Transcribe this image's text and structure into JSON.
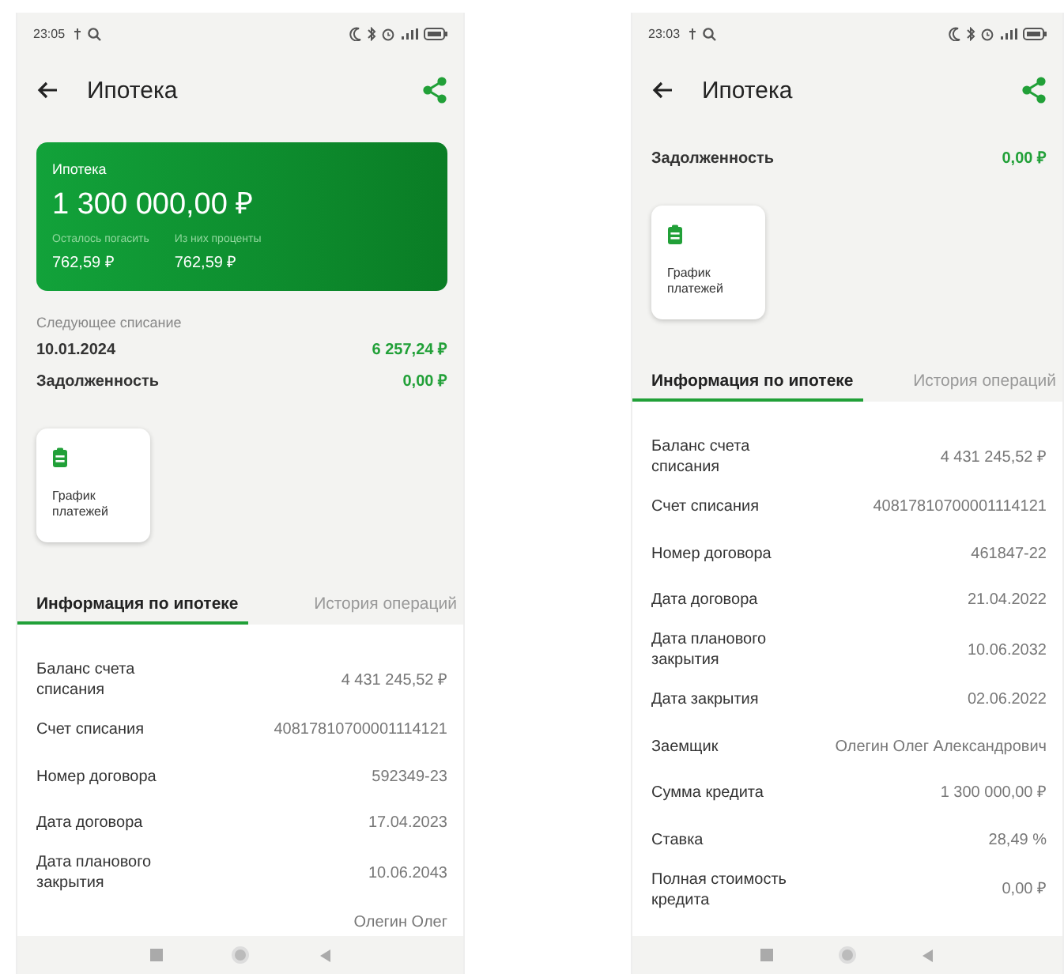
{
  "phones": [
    {
      "status_bar": {
        "time": "23:05"
      },
      "title": "Ипотека",
      "card": {
        "title": "Ипотека",
        "amount": "1 300 000,00 ₽",
        "details": [
          {
            "label": "Осталось погасить",
            "value": "762,59 ₽"
          },
          {
            "label": "Из них проценты",
            "value": "762,59 ₽"
          }
        ]
      },
      "next_payment": {
        "label": "Следующее списание",
        "date": "10.01.2024",
        "amount": "6 257,24 ₽"
      },
      "debt": {
        "label": "Задолженность",
        "amount": "0,00 ₽"
      },
      "tile": {
        "label": "График платежей"
      },
      "tabs": [
        {
          "label": "Информация по ипотеке",
          "selected": true
        },
        {
          "label": "История операций",
          "selected": false
        }
      ],
      "info_rows": [
        {
          "label": "Баланс счета списания",
          "value": "4 431 245,52 ₽"
        },
        {
          "label": "Счет списания",
          "value": "40817810700001114121"
        },
        {
          "label": "Номер договора",
          "value": "592349-23"
        },
        {
          "label": "Дата договора",
          "value": "17.04.2023"
        },
        {
          "label": "Дата планового закрытия",
          "value": "10.06.2043"
        },
        {
          "value": "Олегин Олег"
        }
      ]
    },
    {
      "status_bar": {
        "time": "23:03"
      },
      "title": "Ипотека",
      "debt": {
        "label": "Задолженность",
        "amount": "0,00 ₽"
      },
      "tile": {
        "label": "График платежей"
      },
      "tabs": [
        {
          "label": "Информация по ипотеке",
          "selected": true
        },
        {
          "label": "История операций",
          "selected": false
        }
      ],
      "info_rows": [
        {
          "label": "Баланс счета списания",
          "value": "4 431 245,52 ₽"
        },
        {
          "label": "Счет списания",
          "value": "40817810700001114121"
        },
        {
          "label": "Номер договора",
          "value": "461847-22"
        },
        {
          "label": "Дата договора",
          "value": "21.04.2022"
        },
        {
          "label": "Дата планового закрытия",
          "value": "10.06.2032"
        },
        {
          "label": "Дата закрытия",
          "value": "02.06.2022"
        },
        {
          "label": "Заемщик",
          "value": "Олегин Олег Александрович"
        },
        {
          "label": "Сумма кредита",
          "value": "1 300 000,00 ₽"
        },
        {
          "label": "Ставка",
          "value": "28,49 %"
        },
        {
          "label": "Полная стоимость кредита",
          "value": "0,00 ₽"
        }
      ]
    }
  ]
}
